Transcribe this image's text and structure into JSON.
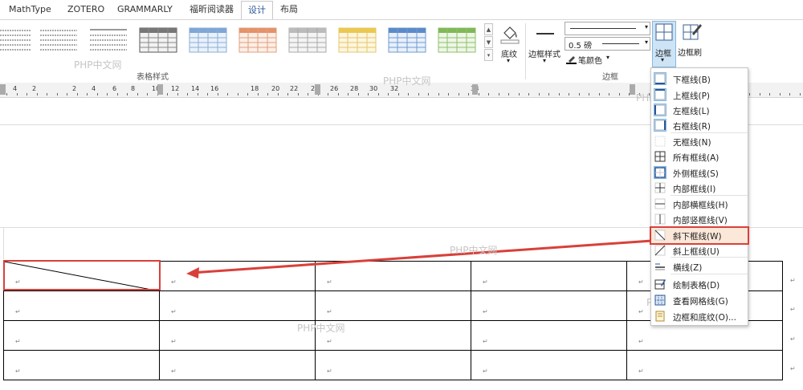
{
  "tabs": [
    {
      "label": "MathType"
    },
    {
      "label": "ZOTERO"
    },
    {
      "label": "GRAMMARLY"
    },
    {
      "label": "福昕阅读器"
    },
    {
      "label": "设计"
    },
    {
      "label": "布局"
    }
  ],
  "ribbon": {
    "table_styles_label": "表格样式",
    "shading_label": "底纹",
    "border_styles_label": "边框样式",
    "line_weight_value": "0.5 磅",
    "pen_color_label": "笔颜色",
    "borders_group_label": "边框",
    "borders_button_label": "边框",
    "border_painter_label": "边框刷"
  },
  "ruler": {
    "numbers": [
      "4",
      "2",
      "",
      "2",
      "4",
      "6",
      "8",
      "10",
      "12",
      "14",
      "16",
      "",
      "18",
      "20",
      "22",
      "24",
      "26",
      "28",
      "30",
      "32",
      "",
      "",
      "",
      "38"
    ]
  },
  "watermarks": [
    "PHP中文网",
    "PHP中文网",
    "PHP中文网",
    "PHP中文网",
    "PHP中文网",
    "PHP中文网"
  ],
  "paragraph_mark": "↵",
  "borders_menu": {
    "items": [
      {
        "label": "下框线(B)",
        "icon": "border-bottom-icon"
      },
      {
        "label": "上框线(P)",
        "icon": "border-top-icon"
      },
      {
        "label": "左框线(L)",
        "icon": "border-left-icon"
      },
      {
        "label": "右框线(R)",
        "icon": "border-right-icon"
      },
      {
        "label": "无框线(N)",
        "icon": "no-border-icon"
      },
      {
        "label": "所有框线(A)",
        "icon": "all-borders-icon"
      },
      {
        "label": "外侧框线(S)",
        "icon": "outside-borders-icon"
      },
      {
        "label": "内部框线(I)",
        "icon": "inside-borders-icon"
      },
      {
        "label": "内部横框线(H)",
        "icon": "inside-horizontal-border-icon"
      },
      {
        "label": "内部竖框线(V)",
        "icon": "inside-vertical-border-icon"
      },
      {
        "label": "斜下框线(W)",
        "icon": "diagonal-down-border-icon"
      },
      {
        "label": "斜上框线(U)",
        "icon": "diagonal-up-border-icon"
      },
      {
        "label": "横线(Z)",
        "icon": "horizontal-line-icon"
      },
      {
        "label": "绘制表格(D)",
        "icon": "draw-table-icon"
      },
      {
        "label": "查看网格线(G)",
        "icon": "view-gridlines-icon"
      },
      {
        "label": "边框和底纹(O)...",
        "icon": "borders-and-shading-icon"
      }
    ]
  },
  "colors": {
    "accent": "#2b579a",
    "highlight_red": "#d9403a",
    "selection": "#fce8d9",
    "pressed": "#cde4f6"
  }
}
